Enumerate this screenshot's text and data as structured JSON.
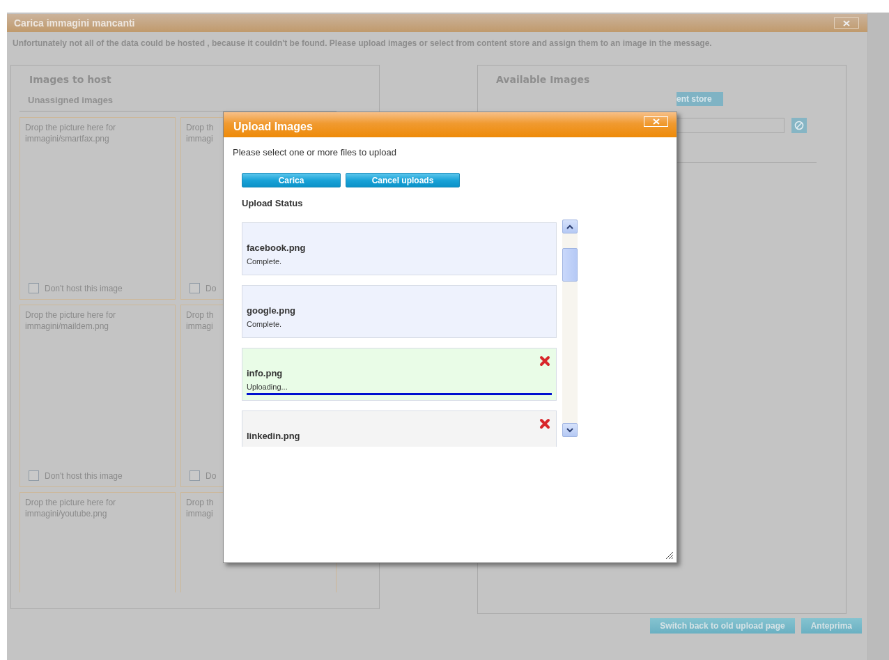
{
  "dialog": {
    "title": "Carica immagini mancanti",
    "message": "Unfortunately not all of the data could be hosted , because it couldn't be found. Please upload images or select from content store and assign them to an image in the message."
  },
  "images_to_host": {
    "heading": "Images to host",
    "subheading": "Unassigned images",
    "cells": [
      {
        "drop_text": "Drop the picture here for",
        "file": "immagini/smartfax.png",
        "checkbox": {
          "label": "Don't host this image",
          "checked": false
        }
      },
      {
        "drop_text": "Drop th",
        "file": "immagi",
        "checkbox": {
          "label": "Do",
          "checked": false
        }
      },
      {
        "drop_text": "Drop the picture here for",
        "file": "immagini/maildem.png",
        "checkbox": {
          "label": "Don't host this image",
          "checked": false
        }
      },
      {
        "drop_text": "Drop th",
        "file": "immagi",
        "checkbox": {
          "label": "Do",
          "checked": false
        }
      },
      {
        "drop_text": "Drop the picture here for",
        "file": "immagini/youtube.png"
      },
      {
        "drop_text": "Drop th",
        "file": "immagi"
      }
    ]
  },
  "available_images": {
    "heading": "Available Images",
    "store_button": "ent store"
  },
  "footer_buttons": [
    "Switch back to old upload page",
    "Anteprima"
  ],
  "upload_dialog": {
    "title": "Upload Images",
    "prompt": "Please select one or more files to upload",
    "buttons": [
      "Carica",
      "Cancel uploads"
    ],
    "status_heading": "Upload Status",
    "files": [
      {
        "name": "facebook.png",
        "status": "Complete.",
        "kind": "complete"
      },
      {
        "name": "google.png",
        "status": "Complete.",
        "kind": "complete"
      },
      {
        "name": "info.png",
        "status": "Uploading...",
        "kind": "uploading",
        "level": 1
      },
      {
        "name": "linkedin.png",
        "kind": "queued"
      }
    ]
  }
}
